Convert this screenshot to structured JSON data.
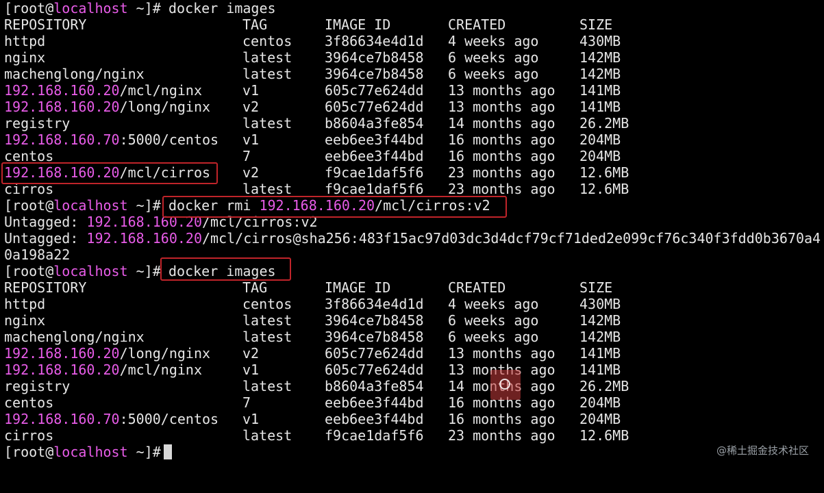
{
  "prompt": {
    "bracket_open": "[",
    "user": "root",
    "at": "@",
    "host": "localhost",
    "path_close": " ~]",
    "symbol": "#"
  },
  "commands": {
    "images_1": "docker images",
    "rmi_prefix": "docker rmi ",
    "rmi_ip": "192.168.160.20",
    "rmi_rest": "/mcl/cirros:v2",
    "images_2": "docker images"
  },
  "headers": {
    "repository": "REPOSITORY",
    "tag": "TAG",
    "image_id": "IMAGE ID",
    "created": "CREATED",
    "size": "SIZE"
  },
  "table1": [
    {
      "ip": "",
      "repo": "httpd",
      "tag": "centos",
      "id": "3f86634e4d1d",
      "created": "4 weeks ago",
      "size": "430MB"
    },
    {
      "ip": "",
      "repo": "nginx",
      "tag": "latest",
      "id": "3964ce7b8458",
      "created": "6 weeks ago",
      "size": "142MB"
    },
    {
      "ip": "",
      "repo": "machenglong/nginx",
      "tag": "latest",
      "id": "3964ce7b8458",
      "created": "6 weeks ago",
      "size": "142MB"
    },
    {
      "ip": "192.168.160.20",
      "repo": "/mcl/nginx",
      "tag": "v1",
      "id": "605c77e624dd",
      "created": "13 months ago",
      "size": "141MB"
    },
    {
      "ip": "192.168.160.20",
      "repo": "/long/nginx",
      "tag": "v2",
      "id": "605c77e624dd",
      "created": "13 months ago",
      "size": "141MB"
    },
    {
      "ip": "",
      "repo": "registry",
      "tag": "latest",
      "id": "b8604a3fe854",
      "created": "14 months ago",
      "size": "26.2MB"
    },
    {
      "ip": "192.168.160.70",
      "repo": ":5000/centos",
      "tag": "v1",
      "id": "eeb6ee3f44bd",
      "created": "16 months ago",
      "size": "204MB"
    },
    {
      "ip": "",
      "repo": "centos",
      "tag": "7",
      "id": "eeb6ee3f44bd",
      "created": "16 months ago",
      "size": "204MB"
    },
    {
      "ip": "192.168.160.20",
      "repo": "/mcl/cirros",
      "tag": "v2",
      "id": "f9cae1daf5f6",
      "created": "23 months ago",
      "size": "12.6MB"
    },
    {
      "ip": "",
      "repo": "cirros",
      "tag": "latest",
      "id": "f9cae1daf5f6",
      "created": "23 months ago",
      "size": "12.6MB"
    }
  ],
  "untagged": [
    {
      "label": "Untagged: ",
      "ip": "192.168.160.20",
      "rest": "/mcl/cirros:v2"
    },
    {
      "label": "Untagged: ",
      "ip": "192.168.160.20",
      "rest": "/mcl/cirros@sha256:483f15ac97d03dc3d4dcf79cf71ded2e099cf76c340f3fdd0b3670a4"
    }
  ],
  "untagged_wrap": "0a198a22",
  "table2": [
    {
      "ip": "",
      "repo": "httpd",
      "tag": "centos",
      "id": "3f86634e4d1d",
      "created": "4 weeks ago",
      "size": "430MB"
    },
    {
      "ip": "",
      "repo": "nginx",
      "tag": "latest",
      "id": "3964ce7b8458",
      "created": "6 weeks ago",
      "size": "142MB"
    },
    {
      "ip": "",
      "repo": "machenglong/nginx",
      "tag": "latest",
      "id": "3964ce7b8458",
      "created": "6 weeks ago",
      "size": "142MB"
    },
    {
      "ip": "192.168.160.20",
      "repo": "/long/nginx",
      "tag": "v2",
      "id": "605c77e624dd",
      "created": "13 months ago",
      "size": "141MB"
    },
    {
      "ip": "192.168.160.20",
      "repo": "/mcl/nginx",
      "tag": "v1",
      "id": "605c77e624dd",
      "created": "13 months ago",
      "size": "141MB"
    },
    {
      "ip": "",
      "repo": "registry",
      "tag": "latest",
      "id": "b8604a3fe854",
      "created": "14 months ago",
      "size": "26.2MB"
    },
    {
      "ip": "",
      "repo": "centos",
      "tag": "7",
      "id": "eeb6ee3f44bd",
      "created": "16 months ago",
      "size": "204MB"
    },
    {
      "ip": "192.168.160.70",
      "repo": ":5000/centos",
      "tag": "v1",
      "id": "eeb6ee3f44bd",
      "created": "16 months ago",
      "size": "204MB"
    },
    {
      "ip": "",
      "repo": "cirros",
      "tag": "latest",
      "id": "f9cae1daf5f6",
      "created": "23 months ago",
      "size": "12.6MB"
    }
  ],
  "watermark": "@稀土掘金技术社区",
  "colors": {
    "background": "#000000",
    "text": "#e6e6e6",
    "ip_highlight": "#e85ce8",
    "annotation_box": "#c0242a"
  }
}
